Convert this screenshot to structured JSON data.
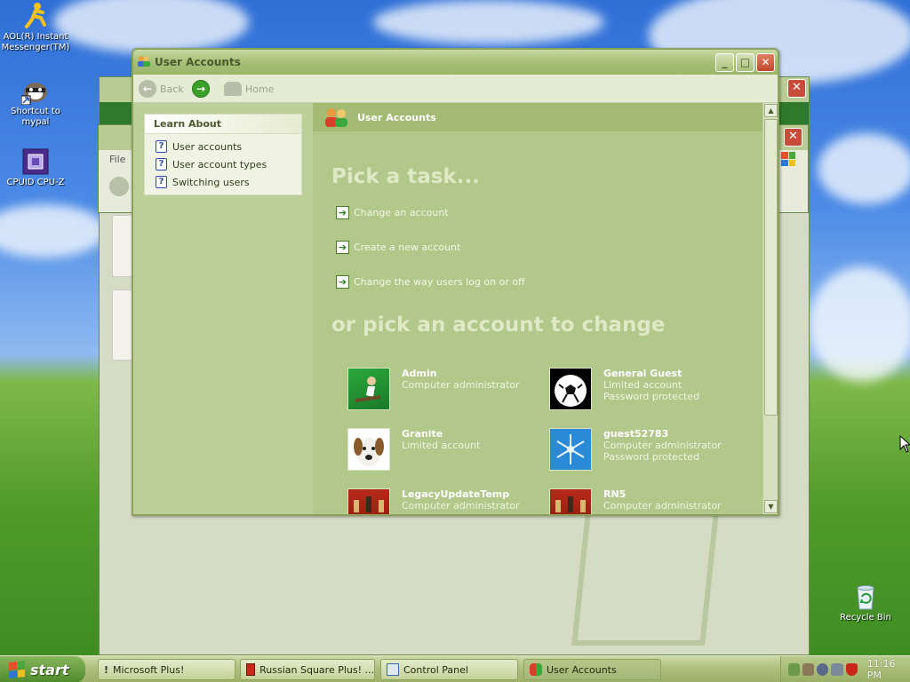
{
  "desktop": {
    "icons": [
      {
        "label": "AOL(R) Instant Messenger(TM)",
        "icon": "aim-running-man-icon"
      },
      {
        "label": "Shortcut to mypal",
        "icon": "mypal-raccoon-icon"
      },
      {
        "label": "CPUID CPU-Z",
        "icon": "cpu-z-chip-icon"
      },
      {
        "label": "Recycle Bin",
        "icon": "recycle-bin-icon"
      }
    ]
  },
  "window": {
    "title": "User Accounts",
    "toolbar": {
      "back_label": "Back",
      "home_label": "Home"
    },
    "learn_about": {
      "heading": "Learn About",
      "items": [
        "User accounts",
        "User account types",
        "Switching users"
      ]
    },
    "header_label": "User Accounts",
    "pick_task_title": "Pick a task...",
    "tasks": [
      "Change an account",
      "Create a new account",
      "Change the way users log on or off"
    ],
    "pick_account_title": "or pick an account to change",
    "accounts": [
      {
        "name": "Admin",
        "line1": "Computer administrator",
        "line2": "",
        "picture": "skateboarder-picture"
      },
      {
        "name": "General Guest",
        "line1": "Limited account",
        "line2": "Password protected",
        "picture": "soccer-ball-picture"
      },
      {
        "name": "Granite",
        "line1": "Limited account",
        "line2": "",
        "picture": "dog-picture"
      },
      {
        "name": "guest52783",
        "line1": "Computer administrator",
        "line2": "Password protected",
        "picture": "snowflake-picture"
      },
      {
        "name": "LegacyUpdateTemp",
        "line1": "Computer administrator",
        "line2": "",
        "picture": "chess-picture"
      },
      {
        "name": "RN5",
        "line1": "Computer administrator",
        "line2": "",
        "picture": "chess-picture"
      }
    ]
  },
  "background_windows": {
    "menu_file": "File"
  },
  "taskbar": {
    "start_label": "start",
    "buttons": [
      "Microsoft Plus!",
      "Russian Square Plus! ...",
      "Control Panel",
      "User Accounts"
    ],
    "active_index": 3,
    "clock": "11:16 PM"
  },
  "colors": {
    "theme_green": "#bccf98",
    "title_text": "#4a5a2e",
    "close_red": "#c2452c"
  }
}
